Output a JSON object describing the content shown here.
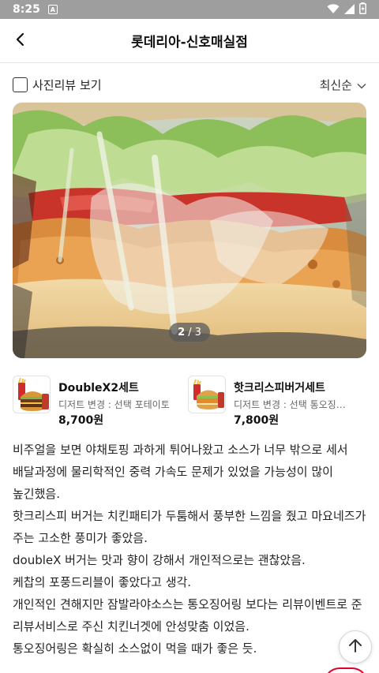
{
  "status_bar": {
    "time": "8:25",
    "app_icon": "A",
    "icons": [
      "wifi-icon",
      "signal-icon",
      "battery-icon"
    ]
  },
  "header": {
    "title": "롯데리아-신호매실점",
    "back_icon": "back-arrow-icon"
  },
  "filter": {
    "photo_review_label": "사진리뷰 보기",
    "photo_review_checked": false,
    "sort_label": "최신순",
    "sort_icon": "chevron-down-icon"
  },
  "photo": {
    "current": "2",
    "separator": "/",
    "total": "3"
  },
  "menu_items": [
    {
      "name": "DoubleX2세트",
      "option": "디저트 변경 : 선택 포테이토",
      "price": "8,700원"
    },
    {
      "name": "핫크리스피버거세트",
      "option": "디저트 변경 : 선택 통오징어링",
      "price": "7,800원"
    }
  ],
  "review": {
    "lines": [
      "비주얼을 보면 야채토핑 과하게 튀어나왔고 소스가 너무 밖으로 세서 배달과정에 물리학적인 중력 가속도 문제가 있었을 가능성이 많이 높긴했음.",
      "핫크리스피 버거는 치킨패티가 두툼해서 풍부한 느낌을 줬고 마요네즈가 주는 고소한 풍미가 좋았음.",
      "doubleX 버거는 맛과 향이 강해서 개인적으로는 괜찮았음.",
      "케찹의 포풍드리블이 좋았다고 생각.",
      "개인적인 견해지만 잠발라야소스는 통오징어링 보다는 리뷰이벤트로 준 리뷰서비스로 주신 치킨너겟에 안성맞춤 이었음.",
      "통오징어링은 확실히 소스없이 먹을 때가 좋은 듯."
    ]
  },
  "scroll_top": {
    "icon": "arrow-up-icon"
  },
  "colors": {
    "accent_red": "#e4002b",
    "status_bar_bg": "#9e9e9e"
  }
}
